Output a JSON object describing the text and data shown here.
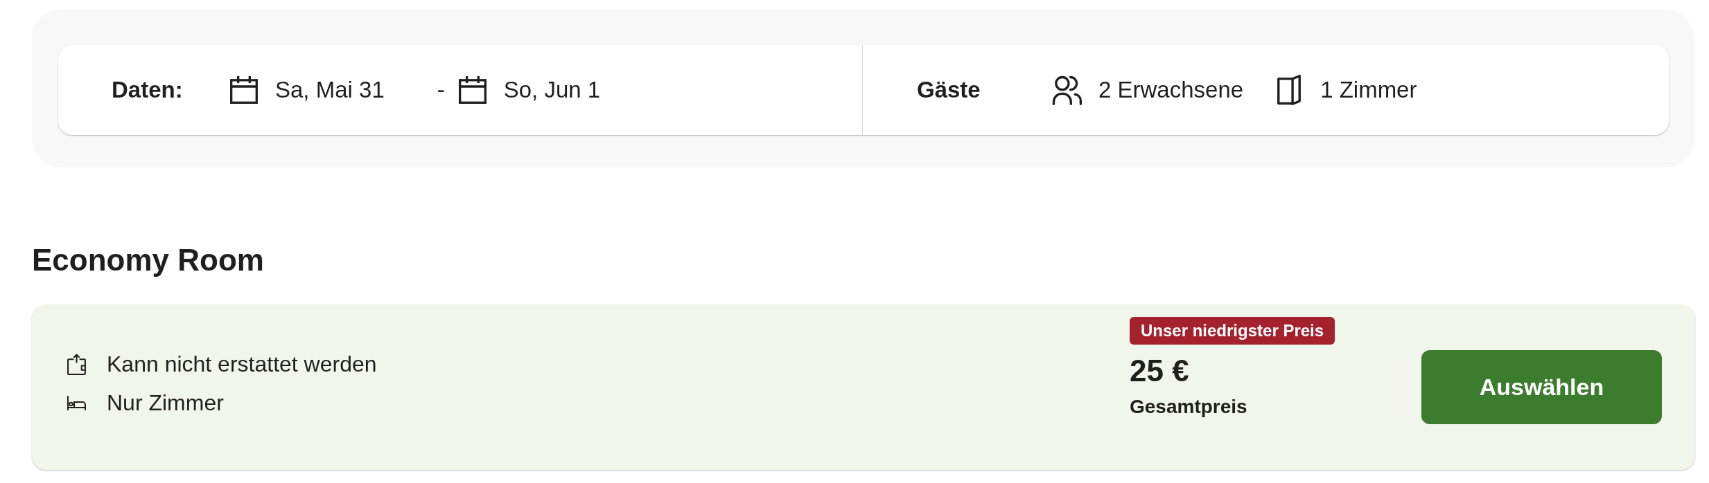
{
  "search_bar": {
    "dates": {
      "label": "Daten:",
      "check_in": "Sa, Mai 31",
      "separator": "-",
      "check_out": "So, Jun 1"
    },
    "guests": {
      "label": "Gäste",
      "adults": "2 Erwachsene",
      "rooms": "1 Zimmer"
    }
  },
  "room": {
    "title": "Economy Room",
    "features": [
      {
        "kind": "refund",
        "text": "Kann nicht erstattet werden"
      },
      {
        "kind": "board",
        "text": "Nur Zimmer"
      }
    ],
    "badge": "Unser niedrigster Preis",
    "price": "25 €",
    "price_label": "Gesamtpreis",
    "select_button": "Auswählen"
  }
}
